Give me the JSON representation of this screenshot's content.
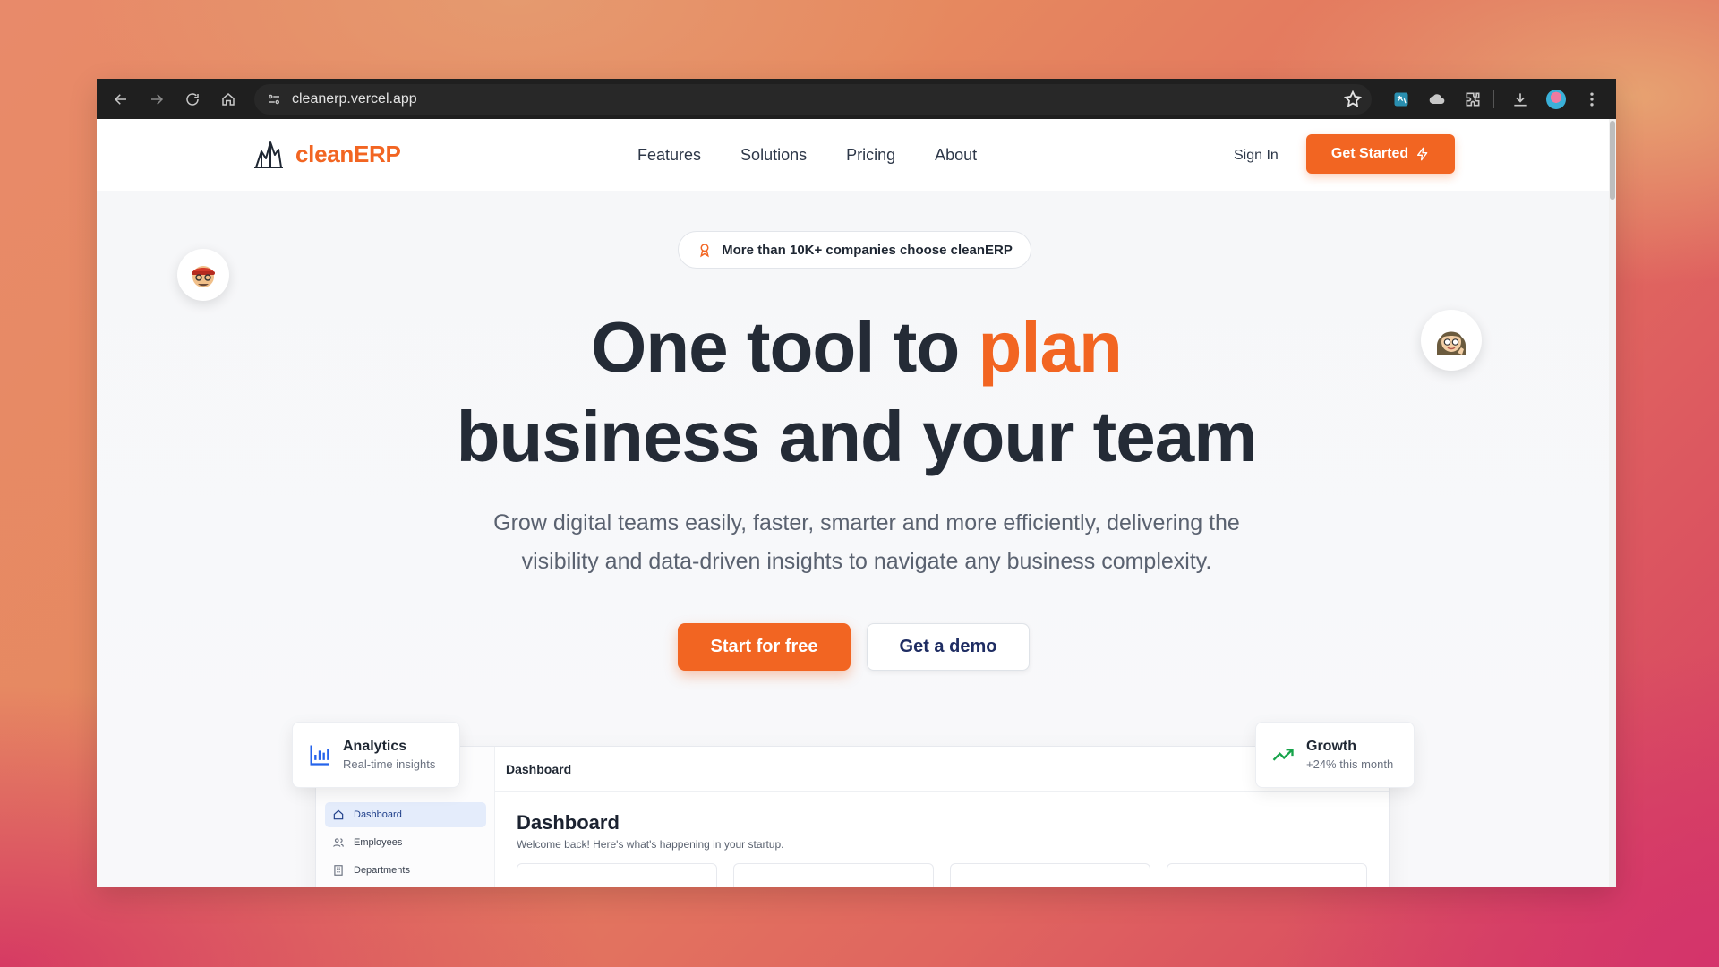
{
  "browser": {
    "url": "cleanerp.vercel.app"
  },
  "site": {
    "logo_text": "cleanERP",
    "nav": [
      "Features",
      "Solutions",
      "Pricing",
      "About"
    ],
    "sign_in": "Sign In",
    "get_started": "Get Started"
  },
  "hero": {
    "badge": "More than 10K+ companies choose cleanERP",
    "title_part1": "One tool to ",
    "title_accent": "plan",
    "title_line2": "business and your team",
    "subtitle": "Grow digital teams easily, faster, smarter and more efficiently, delivering the visibility and data-driven insights to navigate any business complexity.",
    "primary_cta": "Start for free",
    "secondary_cta": "Get a demo"
  },
  "preview": {
    "top_title": "Dashboard",
    "sidebar": [
      "Dashboard",
      "Employees",
      "Departments"
    ],
    "title": "Dashboard",
    "subtitle": "Welcome back! Here's what's happening in your startup."
  },
  "cards": {
    "analytics": {
      "title": "Analytics",
      "subtitle": "Real-time insights"
    },
    "growth": {
      "title": "Growth",
      "subtitle": "+24% this month"
    }
  },
  "colors": {
    "accent": "#f26522",
    "heading": "#242b36",
    "growth": "#16a34a",
    "analytics": "#2563eb"
  }
}
